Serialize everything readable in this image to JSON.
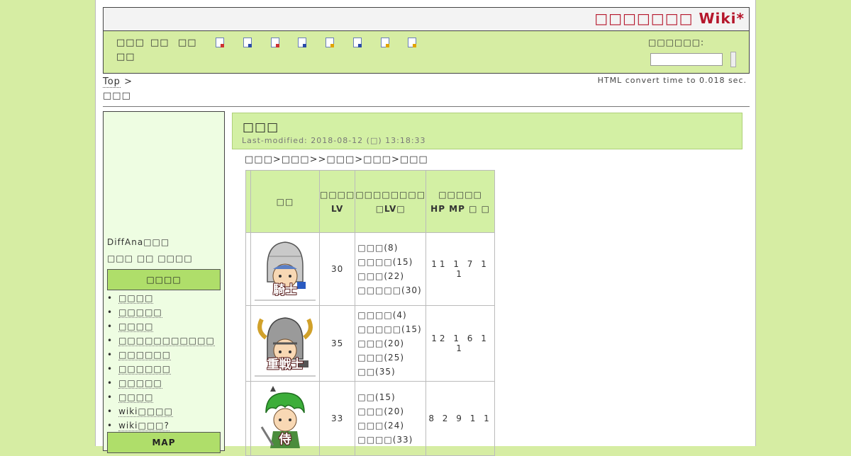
{
  "header": {
    "site_title": "□□□□□□□ Wiki*"
  },
  "nav": {
    "links": [
      "□□□",
      "□□",
      "□□",
      "□□"
    ],
    "search_label": "□□□□□□:"
  },
  "toolbar_icons": [
    "page-new-icon",
    "page-edit-icon",
    "page-diff-icon",
    "page-backup-icon",
    "page-freeze-icon",
    "page-copy-icon",
    "page-list-icon",
    "page-help-icon"
  ],
  "breadcrumb": {
    "top": "Top",
    "sep": " >",
    "current": "□□□"
  },
  "convert_time": "HTML convert time to 0.018 sec.",
  "sidebar": {
    "diffana": "DiffAna□□□",
    "line2": "□□□ □□ □□□□",
    "menu_title": "□□□□",
    "items": [
      "□□□□",
      "□□□□□",
      "□□□□",
      "□□□□□□□□□□□",
      "□□□□□□",
      "□□□□□□",
      "□□□□□",
      "□□□□",
      "wiki□□□□",
      "wiki□□□?"
    ],
    "map_title": "MAP"
  },
  "content": {
    "title": "□□□",
    "last_modified": "Last-modified: 2018-08-12 (□) 13:18:33",
    "path": "□□□>□□□>>□□□>□□□>□□□",
    "table": {
      "headers": [
        "□□",
        "□□□□\nLV",
        "□□□□□□□□\n□LV□",
        "□□□□□\nHP MP □ □"
      ],
      "rows": [
        {
          "portrait_label": "騎士",
          "lv": "30",
          "skills": [
            "□□□(8)",
            "□□□□(15)",
            "□□□(22)",
            "□□□□□(30)"
          ],
          "stats": "11 1 7 1 1"
        },
        {
          "portrait_label": "重戦士",
          "lv": "35",
          "skills": [
            "□□□□(4)",
            "□□□□□(15)",
            "□□□(20)",
            "□□□(25)",
            "□□(35)"
          ],
          "stats": "12 1 6 1 1"
        },
        {
          "portrait_label": "侍",
          "lv": "33",
          "skills": [
            "□□(15)",
            "□□□(20)",
            "□□□(24)",
            "□□□□(33)"
          ],
          "stats": "8 2 9 1 1"
        }
      ]
    }
  }
}
